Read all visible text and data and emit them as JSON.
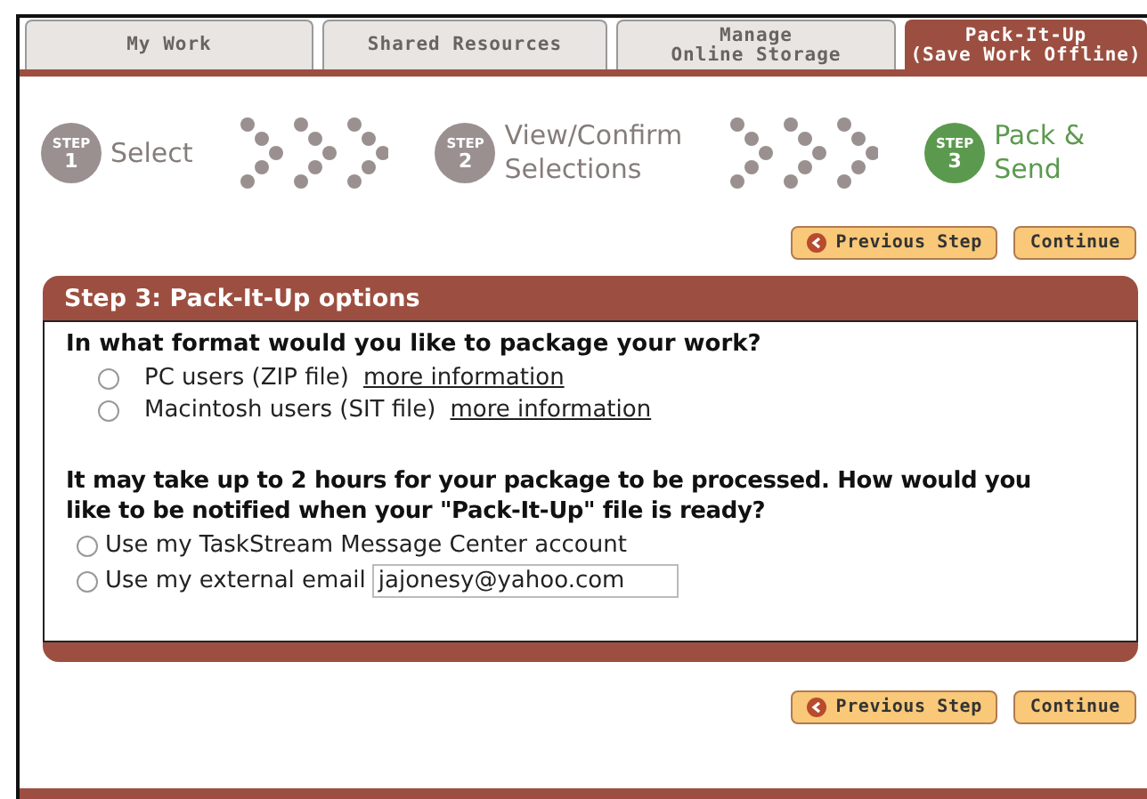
{
  "tabs": [
    {
      "lines": [
        "My Work"
      ],
      "selected": false
    },
    {
      "lines": [
        "Shared Resources"
      ],
      "selected": false
    },
    {
      "lines": [
        "Manage",
        "Online Storage"
      ],
      "selected": false
    },
    {
      "lines": [
        "Pack-It-Up",
        "(Save Work Offline)"
      ],
      "selected": true
    }
  ],
  "steps": [
    {
      "badge": "STEP",
      "number": "1",
      "lines": [
        "Select"
      ],
      "selected": false
    },
    {
      "badge": "STEP",
      "number": "2",
      "lines": [
        "View/Confirm",
        "Selections"
      ],
      "selected": false
    },
    {
      "badge": "STEP",
      "number": "3",
      "lines": [
        "Pack &",
        "Send"
      ],
      "selected": true
    }
  ],
  "top_buttons": [
    {
      "label": "Previous Step",
      "kind": "back"
    },
    {
      "label": "Continue",
      "kind": "plain"
    }
  ],
  "panel": {
    "title": "Step 3: Pack-It-Up options",
    "format_question": "In what format would you like to package your work?",
    "format_options": [
      {
        "label": "PC users (ZIP file)",
        "link": "more information",
        "selected": false
      },
      {
        "label": "Macintosh users (SIT file)",
        "link": "more information",
        "selected": false
      }
    ],
    "notify_question": "It may take up to 2 hours for your package to be processed. How would you like to be notified when your \"Pack-It-Up\" file is ready?",
    "notify_options": [
      {
        "label": "Use my TaskStream Message Center account",
        "selected": false
      },
      {
        "label": "Use my external email",
        "value": "jajonesy@yahoo.com",
        "selected": false
      }
    ]
  },
  "bottom_buttons": [
    {
      "label": "Previous Step",
      "kind": "back"
    },
    {
      "label": "Continue",
      "kind": "plain"
    }
  ]
}
